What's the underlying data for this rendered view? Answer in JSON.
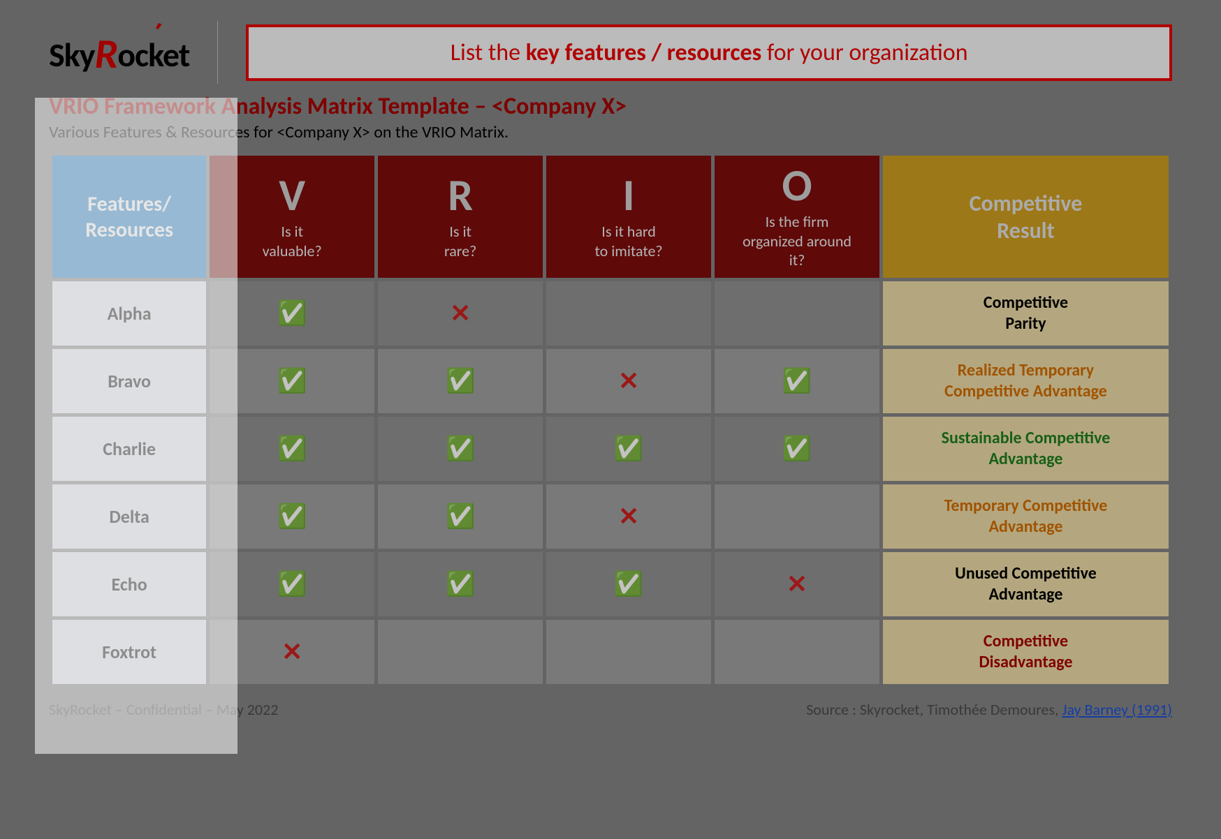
{
  "brand": "SkyRocket",
  "callout_prefix": "List the ",
  "callout_bold": "key features / resources",
  "callout_suffix": " for your organization",
  "title": "VRIO Framework Analysis Matrix Template – <Company X>",
  "subtitle": "Various Features & Resources for <Company X> on the VRIO Matrix.",
  "headers": {
    "features": "Features/\nResources",
    "v_letter": "V",
    "v_q": "Is it\nvaluable?",
    "r_letter": "R",
    "r_q": "Is it\nrare?",
    "i_letter": "I",
    "i_q": "Is it hard\nto imitate?",
    "o_letter": "O",
    "o_q": "Is the firm\norganized around\nit?",
    "result": "Competitive\nResult"
  },
  "icons": {
    "check": "✅",
    "cross": "✕"
  },
  "rows": [
    {
      "name": "Alpha",
      "v": "check",
      "r": "cross",
      "i": "",
      "o": "",
      "result": "Competitive\nParity",
      "result_class": "res-black"
    },
    {
      "name": "Bravo",
      "v": "check",
      "r": "check",
      "i": "cross",
      "o": "check",
      "result": "Realized Temporary\nCompetitive Advantage",
      "result_class": "res-orange"
    },
    {
      "name": "Charlie",
      "v": "check",
      "r": "check",
      "i": "check",
      "o": "check",
      "result": "Sustainable Competitive\nAdvantage",
      "result_class": "res-green"
    },
    {
      "name": "Delta",
      "v": "check",
      "r": "check",
      "i": "cross",
      "o": "",
      "result": "Temporary Competitive\nAdvantage",
      "result_class": "res-orange"
    },
    {
      "name": "Echo",
      "v": "check",
      "r": "check",
      "i": "check",
      "o": "cross",
      "result": "Unused Competitive\nAdvantage",
      "result_class": "res-black"
    },
    {
      "name": "Foxtrot",
      "v": "cross",
      "r": "",
      "i": "",
      "o": "",
      "result": "Competitive\nDisadvantage",
      "result_class": "res-darkred"
    }
  ],
  "footer_left": "SkyRocket – Confidential – May 2022",
  "footer_right_prefix": "Source : Skyrocket, Timothée Demoures,  ",
  "footer_link": "Jay Barney (1991)"
}
